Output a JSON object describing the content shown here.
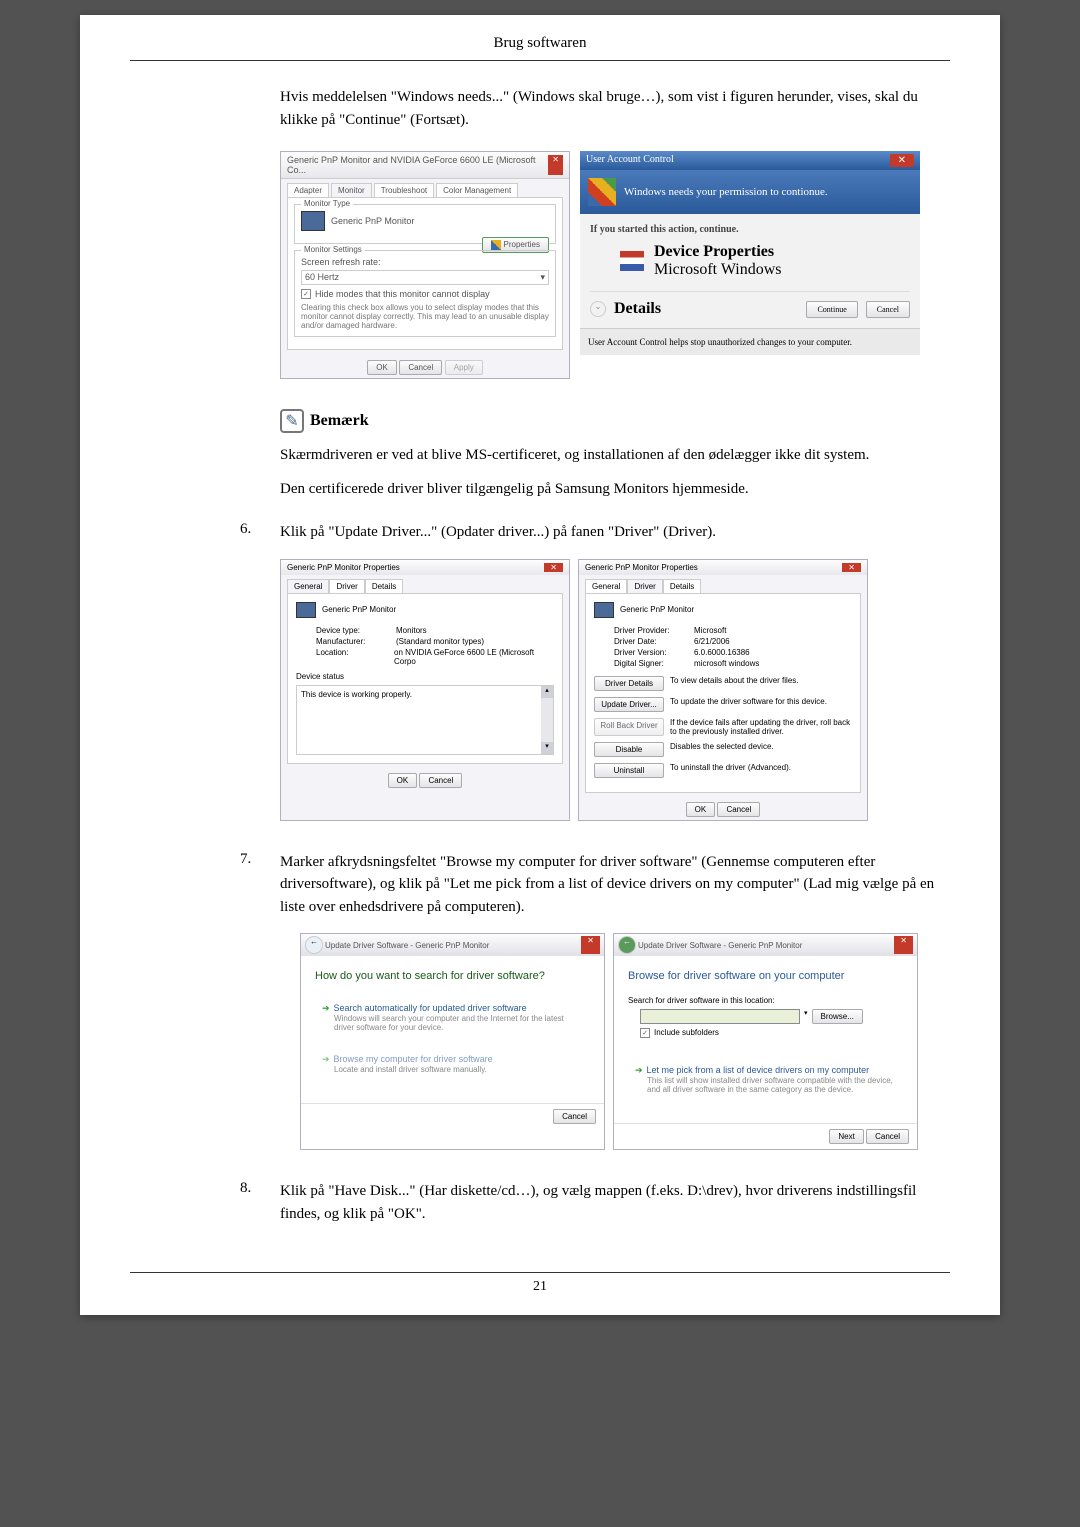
{
  "header": "Brug softwaren",
  "intro": "Hvis meddelelsen \"Windows needs...\" (Windows skal bruge…), som vist i figuren herunder, vises, skal du klikke på \"Continue\" (Fortsæt).",
  "dialog1": {
    "title": "Generic PnP Monitor and NVIDIA GeForce 6600 LE (Microsoft Co...",
    "tabs": [
      "Adapter",
      "Monitor",
      "Troubleshoot",
      "Color Management"
    ],
    "monitor_type_label": "Monitor Type",
    "monitor_name": "Generic PnP Monitor",
    "properties_btn": "Properties",
    "settings_label": "Monitor Settings",
    "refresh_label": "Screen refresh rate:",
    "refresh_value": "60 Hertz",
    "hide_checkbox": "Hide modes that this monitor cannot display",
    "hide_desc": "Clearing this check box allows you to select display modes that this monitor cannot display correctly. This may lead to an unusable display and/or damaged hardware.",
    "ok": "OK",
    "cancel": "Cancel",
    "apply": "Apply"
  },
  "dialog2": {
    "title": "User Account Control",
    "banner": "Windows needs your permission to contionue.",
    "started": "If you started this action, continue.",
    "prop_label": "Device Properties",
    "prop_pub": "Microsoft Windows",
    "details": "Details",
    "continue": "Continue",
    "cancel": "Cancel",
    "footer": "User Account Control helps stop unauthorized changes to your computer."
  },
  "note": {
    "title": "Bemærk",
    "line1": "Skærmdriveren er ved at blive MS-certificeret, og installationen af den ødelægger ikke dit system.",
    "line2": "Den certificerede driver bliver tilgængelig på Samsung Monitors hjemmeside."
  },
  "step6": {
    "num": "6.",
    "text": "Klik på \"Update Driver...\" (Opdater driver...) på fanen \"Driver\" (Driver)."
  },
  "dialog3a": {
    "title": "Generic PnP Monitor Properties",
    "tabs": [
      "General",
      "Driver",
      "Details"
    ],
    "name": "Generic PnP Monitor",
    "dtype_l": "Device type:",
    "dtype_v": "Monitors",
    "manu_l": "Manufacturer:",
    "manu_v": "(Standard monitor types)",
    "loc_l": "Location:",
    "loc_v": "on NVIDIA GeForce 6600 LE (Microsoft Corpo",
    "status_l": "Device status",
    "status_v": "This device is working properly.",
    "ok": "OK",
    "cancel": "Cancel"
  },
  "dialog3b": {
    "title": "Generic PnP Monitor Properties",
    "tabs": [
      "General",
      "Driver",
      "Details"
    ],
    "name": "Generic PnP Monitor",
    "prov_l": "Driver Provider:",
    "prov_v": "Microsoft",
    "date_l": "Driver Date:",
    "date_v": "6/21/2006",
    "ver_l": "Driver Version:",
    "ver_v": "6.0.6000.16386",
    "sign_l": "Digital Signer:",
    "sign_v": "microsoft windows",
    "b1": "Driver Details",
    "b1d": "To view details about the driver files.",
    "b2": "Update Driver...",
    "b2d": "To update the driver software for this device.",
    "b3": "Roll Back Driver",
    "b3d": "If the device fails after updating the driver, roll back to the previously installed driver.",
    "b4": "Disable",
    "b4d": "Disables the selected device.",
    "b5": "Uninstall",
    "b5d": "To uninstall the driver (Advanced).",
    "ok": "OK",
    "cancel": "Cancel"
  },
  "step7": {
    "num": "7.",
    "text": "Marker afkrydsningsfeltet \"Browse my computer for driver software\" (Gennemse computeren efter driversoftware), og klik på \"Let me pick from a list of device drivers on my computer\" (Lad mig vælge på en liste over enhedsdrivere på computeren)."
  },
  "wizard1": {
    "path": "Update Driver Software - Generic PnP Monitor",
    "heading": "How do you want to search for driver software?",
    "opt1": "Search automatically for updated driver software",
    "opt1sub": "Windows will search your computer and the Internet for the latest driver software for your device.",
    "opt2": "Browse my computer for driver software",
    "opt2sub": "Locate and install driver software manually.",
    "cancel": "Cancel"
  },
  "wizard2": {
    "path": "Update Driver Software - Generic PnP Monitor",
    "heading": "Browse for driver software on your computer",
    "search_l": "Search for driver software in this location:",
    "browse": "Browse...",
    "include": "Include subfolders",
    "opt1": "Let me pick from a list of device drivers on my computer",
    "opt1sub": "This list will show installed driver software compatible with the device, and all driver software in the same category as the device.",
    "next": "Next",
    "cancel": "Cancel"
  },
  "step8": {
    "num": "8.",
    "text": "Klik på \"Have Disk...\" (Har diskette/cd…), og vælg mappen (f.eks. D:\\drev), hvor driverens indstillingsfil findes, og klik på \"OK\"."
  },
  "page_num": "21"
}
